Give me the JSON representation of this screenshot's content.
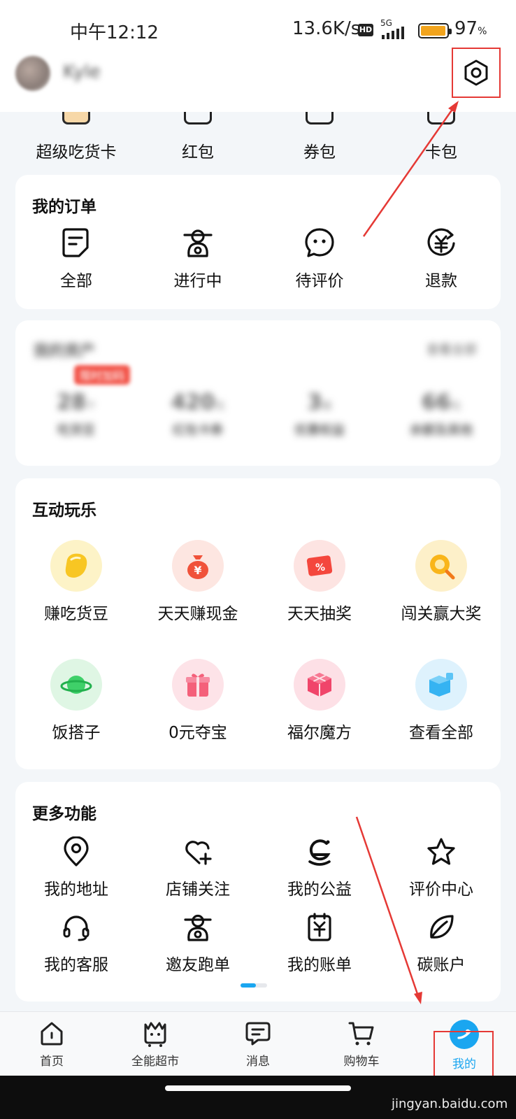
{
  "status_bar": {
    "time": "中午12:12",
    "net_speed": "13.6K/s",
    "hd_badge": "HD",
    "network": "5G",
    "battery_level": 97,
    "battery_text": "97",
    "battery_unit": "%"
  },
  "profile": {
    "username": "Kyle"
  },
  "wallet": [
    {
      "label": "超级吃货卡",
      "icon": "membership-card-icon"
    },
    {
      "label": "红包",
      "icon": "red-packet-icon"
    },
    {
      "label": "券包",
      "icon": "coupon-icon"
    },
    {
      "label": "卡包",
      "icon": "card-wallet-icon"
    }
  ],
  "orders": {
    "title": "我的订单",
    "items": [
      {
        "label": "全部",
        "icon": "document-icon"
      },
      {
        "label": "进行中",
        "icon": "courier-icon"
      },
      {
        "label": "待评价",
        "icon": "chat-bubble-icon"
      },
      {
        "label": "退款",
        "icon": "refund-yuan-icon"
      }
    ]
  },
  "assets": {
    "title": "我的资产",
    "link": "查看全部",
    "badge": "限时加码",
    "items": [
      {
        "value": "28",
        "unit": "个",
        "label": "吃货豆"
      },
      {
        "value": "420",
        "unit": "元",
        "label": "红包卡券"
      },
      {
        "value": "3",
        "unit": "张",
        "label": "优惠权益"
      },
      {
        "value": "66",
        "unit": "元",
        "label": "余额及其他"
      }
    ]
  },
  "fun": {
    "title": "互动玩乐",
    "items": [
      {
        "label": "赚吃货豆",
        "icon": "golden-bean-icon",
        "color": "#f8c623"
      },
      {
        "label": "天天赚现金",
        "icon": "money-bag-icon",
        "color": "#f0523a"
      },
      {
        "label": "天天抽奖",
        "icon": "lottery-ticket-icon",
        "color": "#f4473d"
      },
      {
        "label": "闯关赢大奖",
        "icon": "gold-coin-search-icon",
        "color": "#f9b51a"
      },
      {
        "label": "饭搭子",
        "icon": "planet-icon",
        "color": "#3fd069"
      },
      {
        "label": "0元夺宝",
        "icon": "gift-box-icon",
        "color": "#f4607a"
      },
      {
        "label": "福尔魔方",
        "icon": "magic-cube-icon",
        "color": "#f0456a"
      },
      {
        "label": "查看全部",
        "icon": "cube-icon",
        "color": "#35b3f2"
      }
    ]
  },
  "more": {
    "title": "更多功能",
    "items": [
      {
        "label": "我的地址",
        "icon": "location-pin-icon"
      },
      {
        "label": "店铺关注",
        "icon": "heart-plus-icon"
      },
      {
        "label": "我的公益",
        "icon": "charity-icon"
      },
      {
        "label": "评价中心",
        "icon": "star-icon"
      },
      {
        "label": "我的客服",
        "icon": "headset-icon"
      },
      {
        "label": "邀友跑单",
        "icon": "rider-icon"
      },
      {
        "label": "我的账单",
        "icon": "bill-icon"
      },
      {
        "label": "碳账户",
        "icon": "leaf-icon"
      }
    ]
  },
  "nav": [
    {
      "label": "首页",
      "icon": "home-icon"
    },
    {
      "label": "全能超市",
      "icon": "supermarket-icon"
    },
    {
      "label": "消息",
      "icon": "message-icon"
    },
    {
      "label": "购物车",
      "icon": "cart-icon"
    },
    {
      "label": "我的",
      "icon": "profile-icon"
    }
  ],
  "watermark": "jingyan.baidu.com",
  "accent_color": "#1aa6f0",
  "annotation_color": "#e53935"
}
